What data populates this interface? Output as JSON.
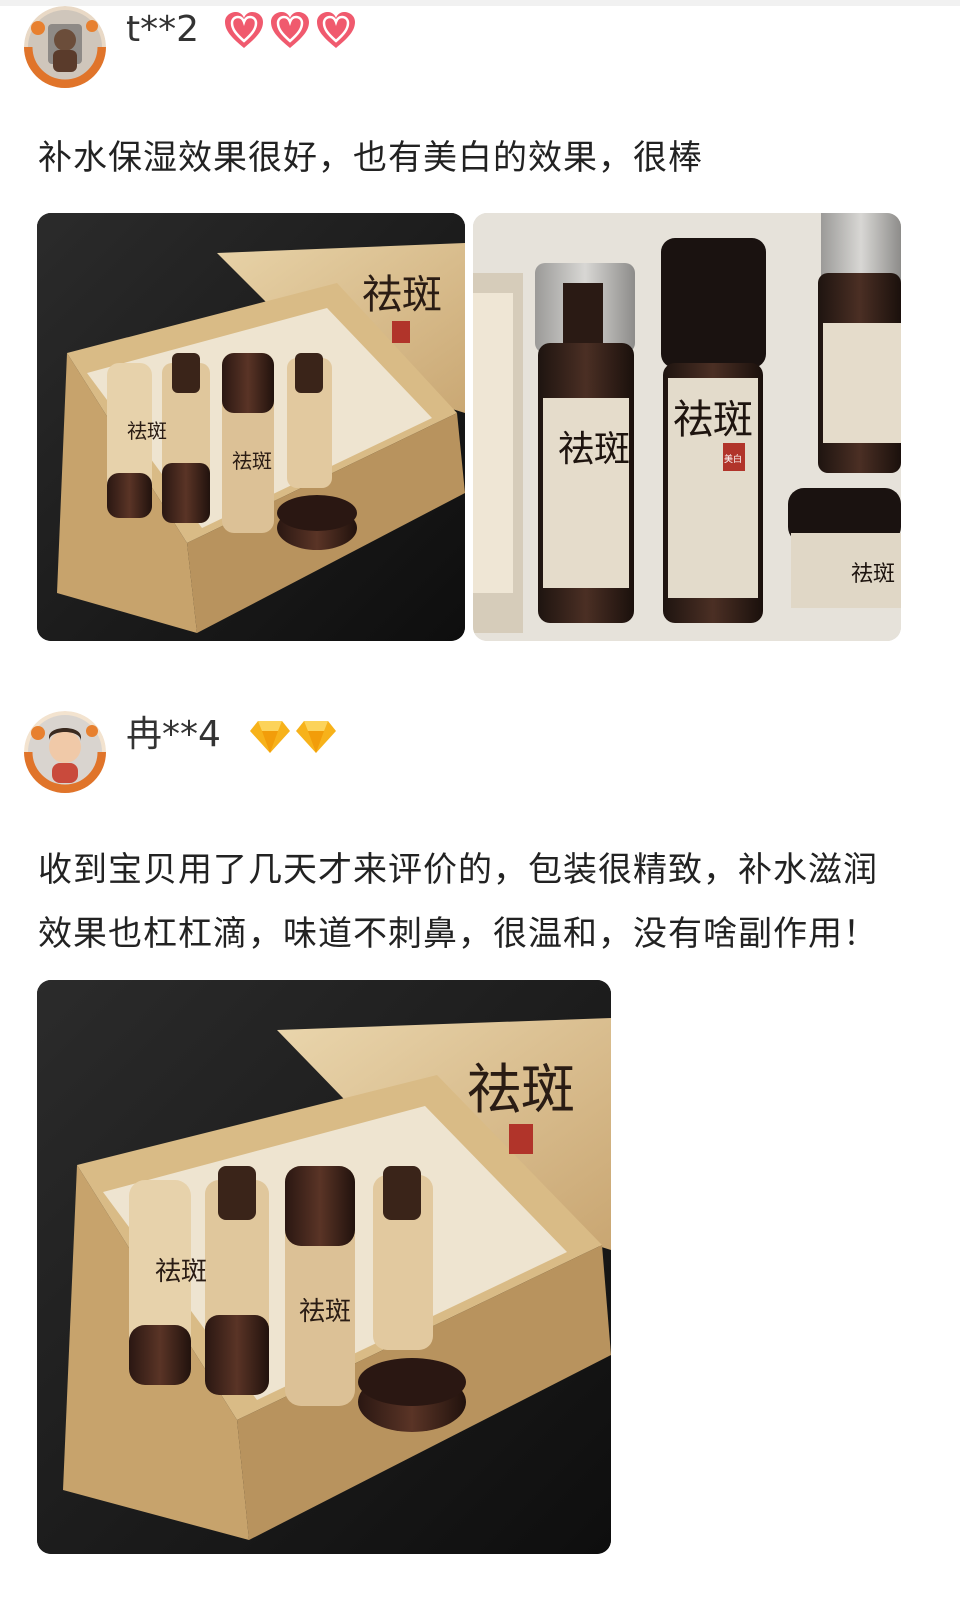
{
  "reviews": [
    {
      "username": "t**2",
      "badge_icons": [
        "heart-gem-icon",
        "heart-gem-icon",
        "heart-gem-icon"
      ],
      "badge_color": "#f05a6e",
      "text_lines": [
        "补水保湿效果很好，也有美白的效果，很棒"
      ],
      "photos": [
        "product-gift-box-photo",
        "product-bottles-closeup-photo"
      ]
    },
    {
      "username": "冉**4",
      "badge_icons": [
        "diamond-icon",
        "diamond-icon"
      ],
      "badge_color": "#f7b21a",
      "text_lines": [
        "收到宝贝用了几天才来评价的，包装很精致，补水滋润",
        "效果也杠杠滴，味道不刺鼻，很温和，没有啥副作用！"
      ],
      "photos": [
        "product-gift-box-photo"
      ]
    }
  ],
  "product_brand_text": "祛斑",
  "product_seal_text": "美白"
}
